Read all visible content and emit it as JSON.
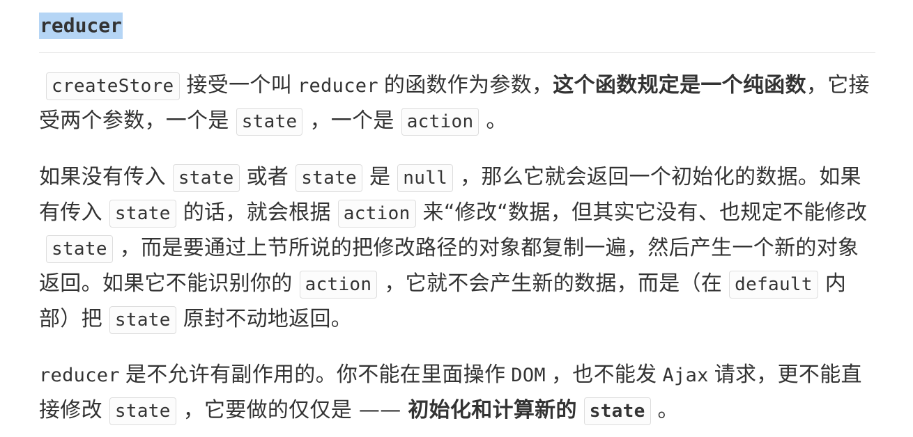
{
  "heading": "reducer",
  "p1": {
    "code_createStore": "createStore",
    "t1": "接受一个叫",
    "word_reducer": "reducer",
    "t2": "的函数作为参数，",
    "bold": "这个函数规定是一个纯函数",
    "t3": "，它接受两个参数，一个是",
    "code_state": "state",
    "t4": "，一个是",
    "code_action": "action",
    "t5": "。"
  },
  "p2": {
    "t1": "如果没有传入",
    "code_state_1": "state",
    "t2": "或者",
    "code_state_2": "state",
    "t3": "是",
    "code_null": "null",
    "t4": "，那么它就会返回一个初始化的数据。如果有传入",
    "code_state_3": "state",
    "t5": "的话，就会根据",
    "code_action_1": "action",
    "t6": "来“修改“数据，但其实它没有、也规定不能修改",
    "code_state_4": "state",
    "t7": "，而是要通过上节所说的把修改路径的对象都复制一遍，然后产生一个新的对象返回。如果它不能识别你的",
    "code_action_2": "action",
    "t8": "，它就不会产生新的数据，而是（在",
    "code_default": "default",
    "t9": "内部）把",
    "code_state_5": "state",
    "t10": "原封不动地返回。"
  },
  "p3": {
    "word_reducer": "reducer",
    "t1": "是不允许有副作用的。你不能在里面操作",
    "word_dom": "DOM",
    "t2": "，也不能发",
    "word_ajax": "Ajax",
    "t3": "请求，更不能直接修改",
    "code_state": "state",
    "t4": "，它要做的仅仅是 —— ",
    "bold": "初始化和计算新的",
    "bold_code_state": "state",
    "t5": "。"
  }
}
